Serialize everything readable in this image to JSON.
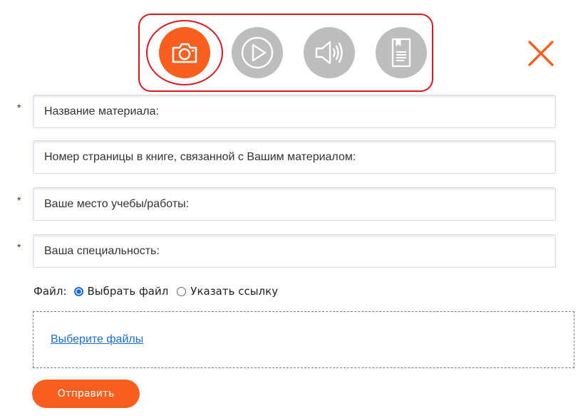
{
  "media_types": [
    {
      "name": "photo",
      "icon": "camera-icon",
      "active": true
    },
    {
      "name": "video",
      "icon": "play-icon",
      "active": false
    },
    {
      "name": "audio",
      "icon": "speaker-icon",
      "active": false
    },
    {
      "name": "document",
      "icon": "document-icon",
      "active": false
    }
  ],
  "close_icon": "close-icon",
  "colors": {
    "accent": "#f85e1d",
    "inactive_icon": "#bdbdbd",
    "highlight_border": "#e0161f",
    "link": "#1a6fd6"
  },
  "form": {
    "required_mark": "*",
    "fields": {
      "material_title": {
        "placeholder": "Название материала:",
        "value": "",
        "required": true
      },
      "page_number": {
        "placeholder": "Номер страницы в книге, связанной с Вашим материалом:",
        "value": "",
        "required": false
      },
      "workplace": {
        "placeholder": "Ваше место учебы/работы:",
        "value": "",
        "required": true
      },
      "specialty": {
        "placeholder": "Ваша специальность:",
        "value": "",
        "required": true
      }
    },
    "file": {
      "label": "Файл:",
      "options": [
        {
          "label": "Выбрать файл",
          "selected": true
        },
        {
          "label": "Указать ссылку",
          "selected": false
        }
      ],
      "choose_files_link": "Выберите файлы"
    },
    "submit_label": "Отправить"
  }
}
